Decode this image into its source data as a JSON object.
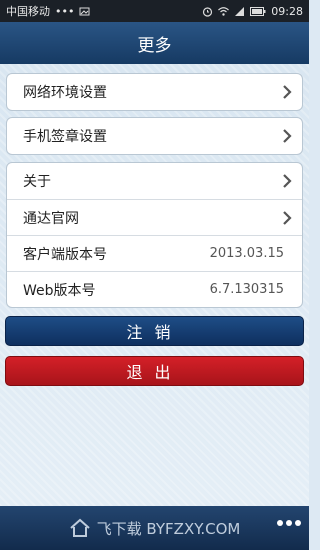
{
  "status": {
    "carrier": "中国移动",
    "dots": "•••",
    "time": "09:28"
  },
  "header": {
    "title": "更多"
  },
  "settings": {
    "network": "网络环境设置",
    "signature": "手机签章设置"
  },
  "info": {
    "about": "关于",
    "website": "通达官网",
    "client_version_label": "客户端版本号",
    "client_version_value": "2013.03.15",
    "web_version_label": "Web版本号",
    "web_version_value": "6.7.130315"
  },
  "buttons": {
    "logout": "注销",
    "exit": "退出"
  },
  "bottom": {
    "watermark": "飞下载 BYFZXY.COM"
  },
  "colors": {
    "header": "#163a63",
    "logout": "#0e2f5f",
    "exit": "#c8171f"
  }
}
